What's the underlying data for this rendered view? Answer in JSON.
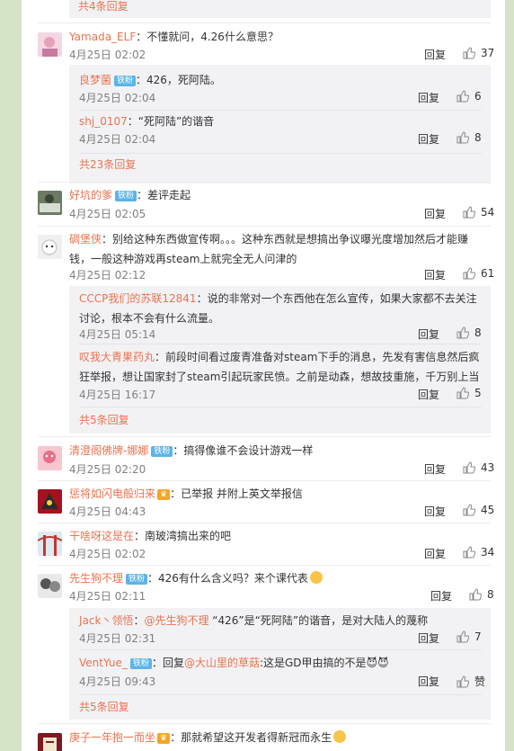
{
  "top_more": "共4条回复",
  "reply_label": "回复",
  "like_label_zan": "赞",
  "badge_fan": "铁粉",
  "comments": [
    {
      "user": "Yamada_ELF",
      "text": "：不懂就问，4.26什么意思？",
      "time": "4月25日 02:02",
      "likes": "37"
    },
    {
      "user": "好坑的爹",
      "text": "：差评走起",
      "time": "4月25日 02:05",
      "likes": "54"
    },
    {
      "user": "碉堡侠",
      "text": "：别给这种东西做宣传啊。。。这种东西就是想搞出争议曝光度增加然后才能赚",
      "text2": "钱，一般这种游戏再steam上就完全无人问津的",
      "time": "4月25日 02:12",
      "likes": "61"
    },
    {
      "user": "清澄阁佛牌-娜娜",
      "text": "：搞得像谁不会设计游戏一样",
      "time": "4月25日 02:20",
      "likes": "43"
    },
    {
      "user": "惩将如闪电般归来",
      "text": "：已举报 并附上英文举报信",
      "time": "4月25日 04:43",
      "likes": "45"
    },
    {
      "user": "干啥呀这是在",
      "text": "：南玻湾搞出来的吧",
      "time": "4月25日 02:02",
      "likes": "34"
    },
    {
      "user": "先生狗不理",
      "text": "：426有什么含义吗？来个课代表",
      "time": "4月25日 02:11",
      "likes": "8"
    },
    {
      "user": "庚子一年抱一而坐",
      "text": "：那就希望这开发者得新冠而永生"
    }
  ],
  "replies_1": [
    {
      "user": "良梦菌",
      "text": "：426，死阿陆。",
      "time": "4月25日 02:04",
      "likes": "6"
    },
    {
      "user": "shj_0107",
      "text": "：“死阿陆”的谐音",
      "time": "4月25日 02:04",
      "likes": "8"
    }
  ],
  "more_1": "共23条回复",
  "replies_2": [
    {
      "user": "CCCP我们的苏联12841",
      "text": "：说的非常对一个东西他在怎么宣传，如果大家都不去关注",
      "text2": "讨论，根本不会有什么流量。",
      "time": "4月25日 05:14",
      "likes": "8"
    },
    {
      "user": "叹我大青果药丸",
      "text": "：前段时间看过废青准备对steam下手的消息，先发有害信息然后疯",
      "text2": "狂举报，想让国家封了steam引起玩家民愤。之前是动森，想故技重施，千万别上当",
      "time": "4月25日 16:17",
      "likes": "5"
    }
  ],
  "more_2": "共5条回复",
  "replies_3": [
    {
      "user": "Jack丶领悟",
      "mention": "@先生狗不理",
      "text": "：",
      "text_after": " “426”是“死阿陆”的谐音，是对大陆人的蔑称",
      "time": "4月25日 02:31",
      "likes": "7"
    },
    {
      "user": "VentYue_",
      "prefix": "：回复",
      "mention": "@大山里的草菇",
      "text_after": ":这是GD甲由搞的不是",
      "time": "4月25日 09:43"
    }
  ],
  "more_3": "共5条回复",
  "colors": {
    "accent": "#eb7350",
    "background": "#d5e4c7",
    "badge": "#5cb4e8"
  }
}
